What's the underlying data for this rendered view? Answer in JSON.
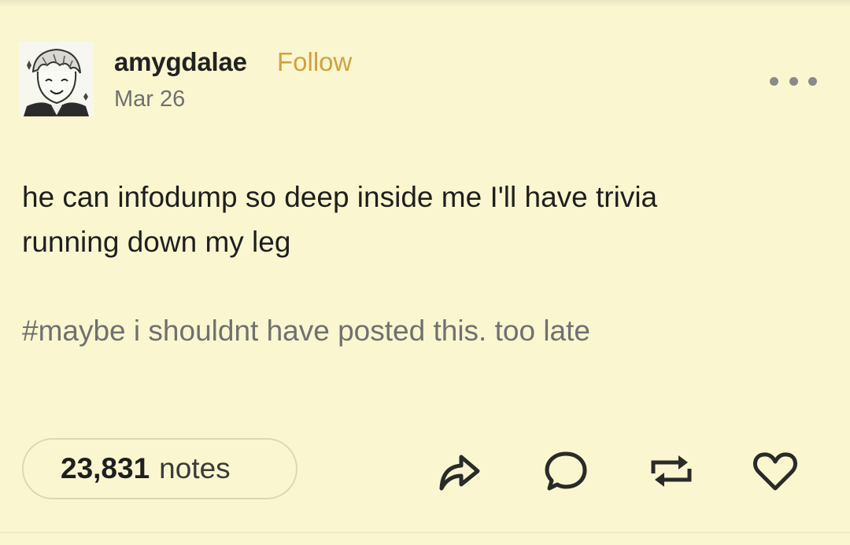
{
  "post": {
    "username": "amygdalae",
    "follow_label": "Follow",
    "date": "Mar 26",
    "body_lines": [
      "he can infodump so deep inside me I'll have trivia",
      "running down my leg"
    ],
    "tags": "#maybe i shouldnt have posted this. too late"
  },
  "footer": {
    "notes_count": "23,831",
    "notes_label": "notes",
    "actions": [
      "share-icon",
      "comment-icon",
      "reblog-icon",
      "heart-icon"
    ]
  },
  "colors": {
    "background": "#faf7d0",
    "follow_accent": "#d3a13c",
    "muted_text": "#707070"
  }
}
